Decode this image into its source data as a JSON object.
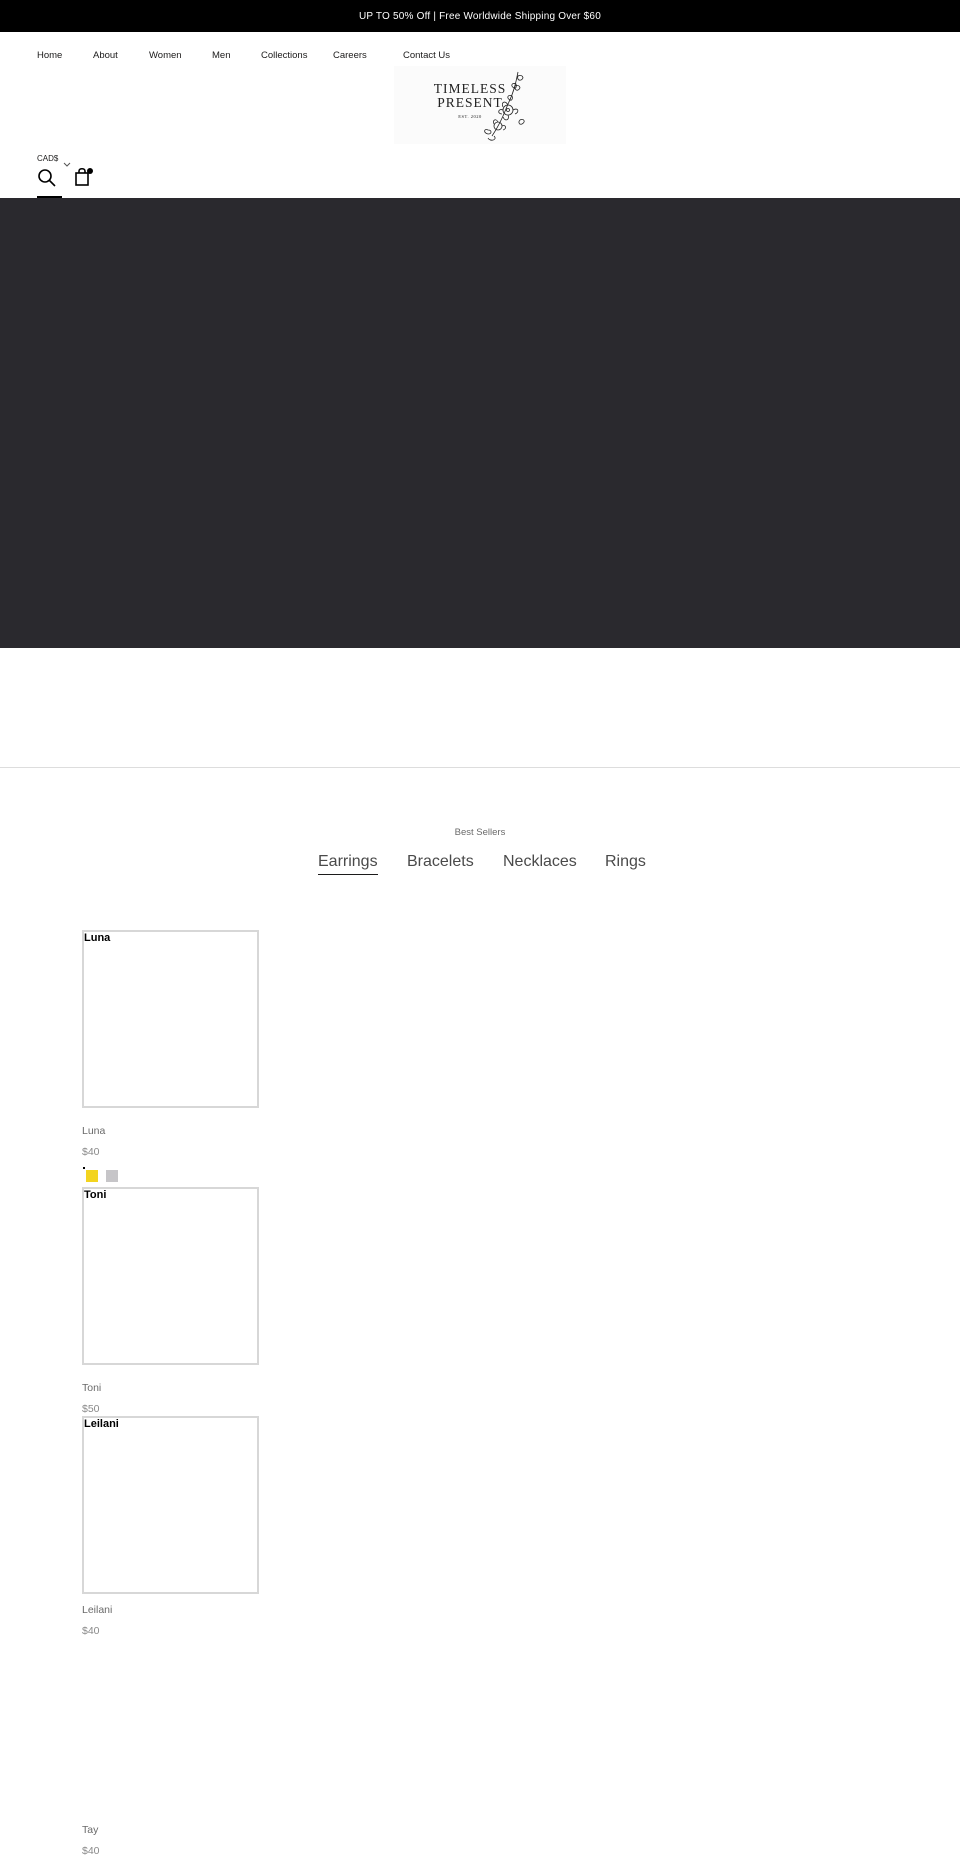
{
  "announcement": {
    "text": "UP TO 50% Off | Free Worldwide Shipping Over $60"
  },
  "nav": {
    "items": [
      "Home",
      "About",
      "Women",
      "Men",
      "Collections",
      "Careers",
      "Contact Us"
    ]
  },
  "logo": {
    "line1": "TIMELESS",
    "line2": "PRESENT",
    "est": "EST. 2020"
  },
  "header": {
    "currency": "CAD$",
    "search_icon": "search-icon",
    "cart_icon": "shopping-bag-icon"
  },
  "colors": {
    "announcement_bg": "#000000",
    "hero_bg": "#2a292e",
    "swatch_gold": "#f3d41f",
    "swatch_silver": "#c6c5c8"
  },
  "best_sellers": {
    "label": "Best Sellers",
    "tabs": [
      "Earrings",
      "Bracelets",
      "Necklaces",
      "Rings"
    ],
    "active_tab": "Earrings"
  },
  "products": [
    {
      "image_alt": "Luna",
      "name": "Luna",
      "price": "$40"
    },
    {
      "image_alt": "Toni",
      "name": "Toni",
      "price": "$50"
    },
    {
      "image_alt": "Leilani",
      "name": "Leilani",
      "price": "$40"
    },
    {
      "name": "Tay",
      "price": "$40"
    }
  ]
}
